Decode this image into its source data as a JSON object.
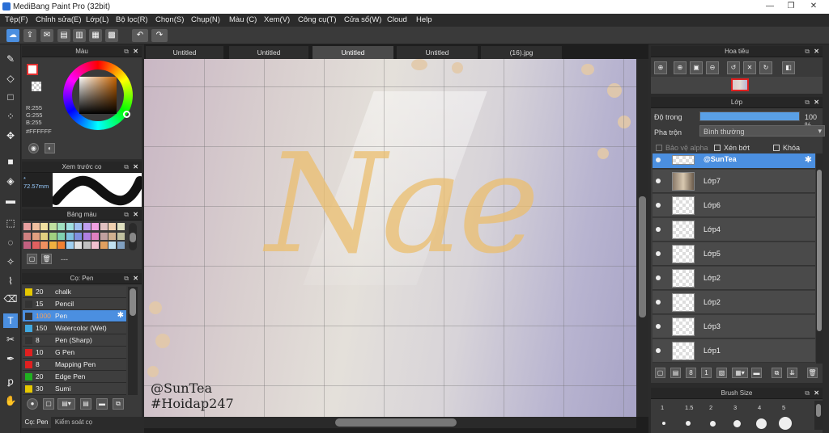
{
  "window": {
    "title": "MediBang Paint Pro (32bit)",
    "min": "—",
    "restore": "❐",
    "close": "✕"
  },
  "menu": [
    "Tệp(F)",
    "Chỉnh sửa(E)",
    "Lớp(L)",
    "Bộ lọc(R)",
    "Chọn(S)",
    "Chụp(N)",
    "Màu (C)",
    "Xem(V)",
    "Công cụ(T)",
    "Cửa sổ(W)",
    "Cloud",
    "Help"
  ],
  "tabs": [
    "Untitled",
    "Untitled",
    "Untitled",
    "Untitled",
    "(16).jpg"
  ],
  "color_panel": {
    "title": "Màu",
    "r": "R:255",
    "g": "G:255",
    "b": "B:255",
    "hex": "#FFFFFF"
  },
  "brush_preview": {
    "title": "Xem trước cọ",
    "size": "72.57mm"
  },
  "palette": {
    "title": "Bảng màu",
    "value": "---",
    "colors": [
      "#e8a0a0",
      "#f0c0a0",
      "#f0e0a0",
      "#c0e0a0",
      "#a0e0c0",
      "#a0e0e0",
      "#a0c0f0",
      "#c0a0f0",
      "#f0a0e0",
      "#e0c0c0",
      "#f0d0b0",
      "#e0e0c0",
      "#d08080",
      "#e0a080",
      "#e0d080",
      "#a0d080",
      "#80d0b0",
      "#80c0e0",
      "#8090e0",
      "#b080e0",
      "#e080c0",
      "#c0a0a0",
      "#d0b090",
      "#c0c0a0",
      "#c06080",
      "#e06060",
      "#f09060",
      "#f0b040",
      "#f08030",
      "#a0d0f0",
      "#e0e0e0",
      "#c0c0c0",
      "#f0c0d0",
      "#e0a060",
      "#c0e0f0",
      "#80a0c0"
    ]
  },
  "brush_panel": {
    "title": "Cọ: Pen",
    "items": [
      {
        "size": "20",
        "name": "chalk",
        "color": "#e6c800"
      },
      {
        "size": "15",
        "name": "Pencil",
        "color": "#333333"
      },
      {
        "size": "1000",
        "name": "Pen",
        "color": "#333333",
        "selected": true
      },
      {
        "size": "150",
        "name": "Watercolor (Wet)",
        "color": "#40a8e0"
      },
      {
        "size": "8",
        "name": "Pen (Sharp)",
        "color": "#333333"
      },
      {
        "size": "10",
        "name": "G Pen",
        "color": "#e02020"
      },
      {
        "size": "8",
        "name": "Mapping Pen",
        "color": "#e02020"
      },
      {
        "size": "20",
        "name": "Edge Pen",
        "color": "#20b020"
      },
      {
        "size": "30",
        "name": "Sumi",
        "color": "#e6c800"
      }
    ],
    "bottom_tabs": [
      "Cọ: Pen",
      "Kiểm soát cọ"
    ]
  },
  "navigator": {
    "title": "Hoa tiêu"
  },
  "layer_panel": {
    "title": "Lớp",
    "opacity_label": "Độ trong",
    "opacity": 100,
    "opacity_text": "100 %",
    "blend_label": "Pha trộn",
    "blend_value": "Bình thường",
    "protect_alpha": "Bảo vệ alpha",
    "clipping": "Xén bớt",
    "lock": "Khóa",
    "layers": [
      "@SunTea",
      "Lớp7",
      "Lớp6",
      "Lớp4",
      "Lớp5",
      "Lớp2",
      "Lớp2",
      "Lớp3",
      "Lớp1"
    ]
  },
  "brush_size": {
    "title": "Brush Size",
    "sizes": [
      "1",
      "1.5",
      "2",
      "3",
      "4",
      "5"
    ]
  },
  "watermark": {
    "line1": "@SunTea",
    "line2": "#Hoidap247"
  },
  "art_text": "Nae"
}
